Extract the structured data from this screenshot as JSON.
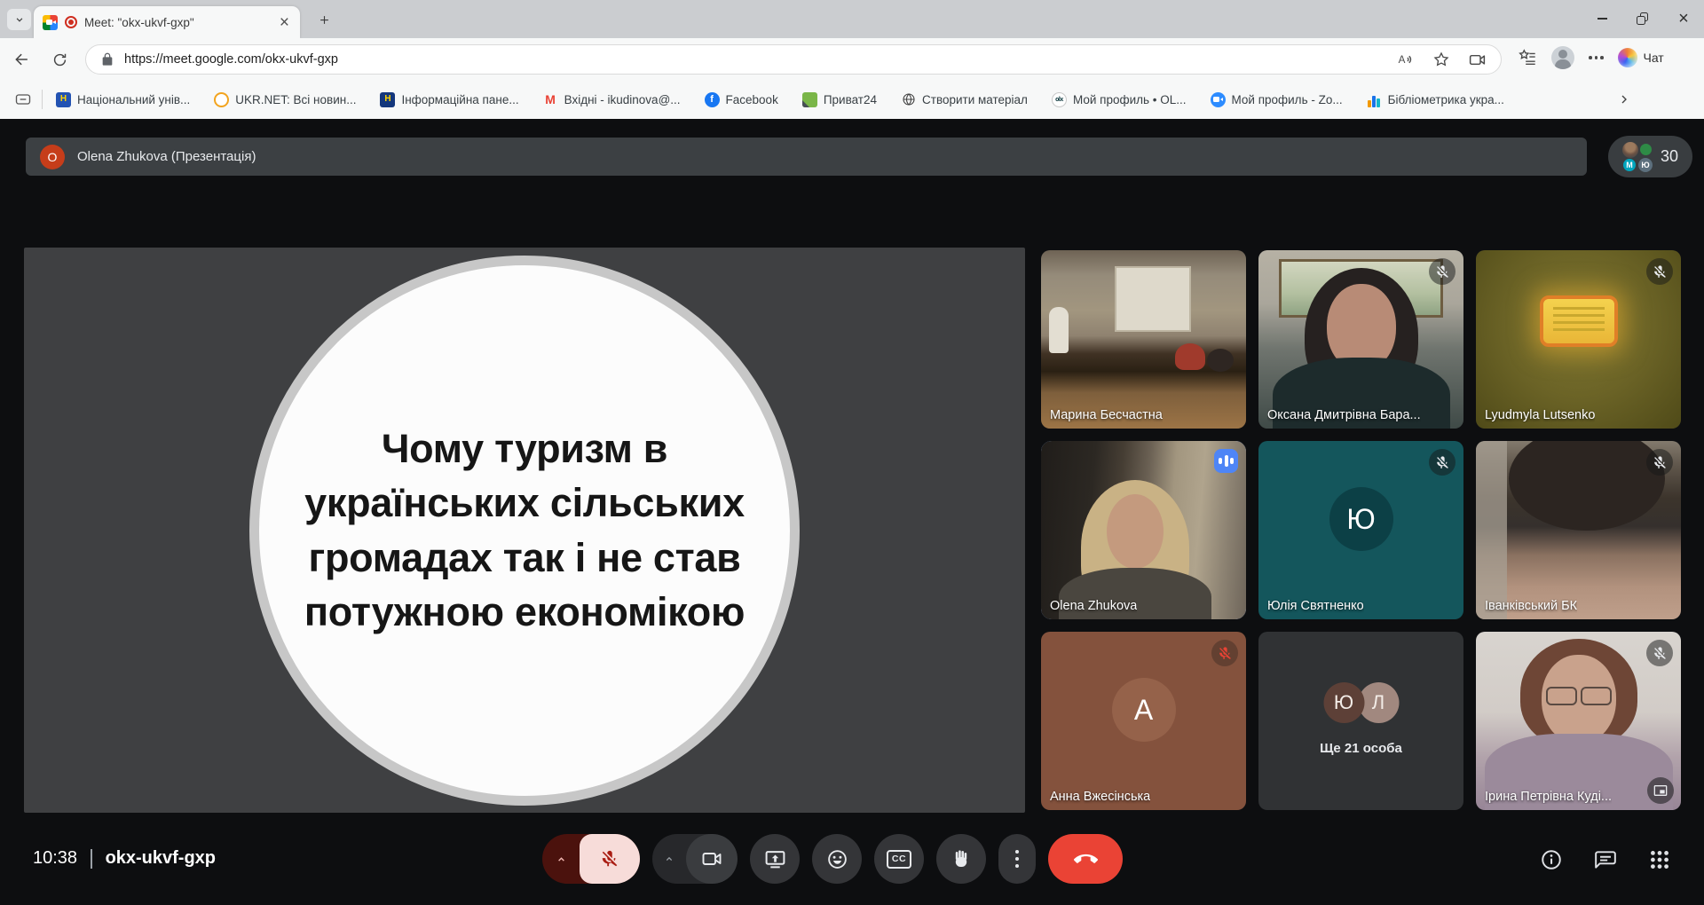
{
  "browser": {
    "tab_title": "Meet: \"okx-ukvf-gxp\"",
    "url": "https://meet.google.com/okx-ukvf-gxp",
    "copilot_label": "Чат",
    "bookmarks": [
      {
        "label": "Національний унів...",
        "glyph": "Н"
      },
      {
        "label": "UKR.NET: Всі новин...",
        "glyph": ""
      },
      {
        "label": "Інформаційна пане...",
        "glyph": "Н"
      },
      {
        "label": "Вхідні - ikudinova@...",
        "glyph": "M"
      },
      {
        "label": "Facebook",
        "glyph": "f"
      },
      {
        "label": "Приват24",
        "glyph": ""
      },
      {
        "label": "Створити матеріал",
        "glyph": ""
      },
      {
        "label": "Мой профиль • OL...",
        "glyph": "olx"
      },
      {
        "label": "Мой профиль - Zo...",
        "glyph": ""
      },
      {
        "label": "Бібліометрика укра...",
        "glyph": ""
      }
    ]
  },
  "meet": {
    "banner": {
      "avatar_initial": "O",
      "title": "Olena Zhukova (Презентація)"
    },
    "participants": {
      "count": "30",
      "letters": [
        "M",
        "Ю"
      ]
    },
    "slide": {
      "lines": [
        "Чому туризм в",
        "українських сільських",
        "громадах так і не став",
        "потужною економікою"
      ]
    },
    "tiles": [
      {
        "name": "Марина Бесчастна"
      },
      {
        "name": "Оксана Дмитрівна Бара...",
        "muted": true
      },
      {
        "name": "Lyudmyla Lutsenko",
        "muted": true
      },
      {
        "name": "Olena Zhukova",
        "speaking": true
      },
      {
        "name": "Юлія Святненко",
        "initial": "Ю",
        "muted": true
      },
      {
        "name": "Іванківський БК",
        "muted": true
      },
      {
        "name": "Анна Вжесінська",
        "initial": "А",
        "muted": true
      },
      {
        "name": "Ще 21 особа",
        "initials": [
          "Ю",
          "Л"
        ]
      },
      {
        "name": "Ірина Петрівна Куді...",
        "muted": true
      }
    ],
    "controls": {
      "time": "10:38",
      "code": "okx-ukvf-gxp",
      "cc_label": "CC"
    }
  }
}
